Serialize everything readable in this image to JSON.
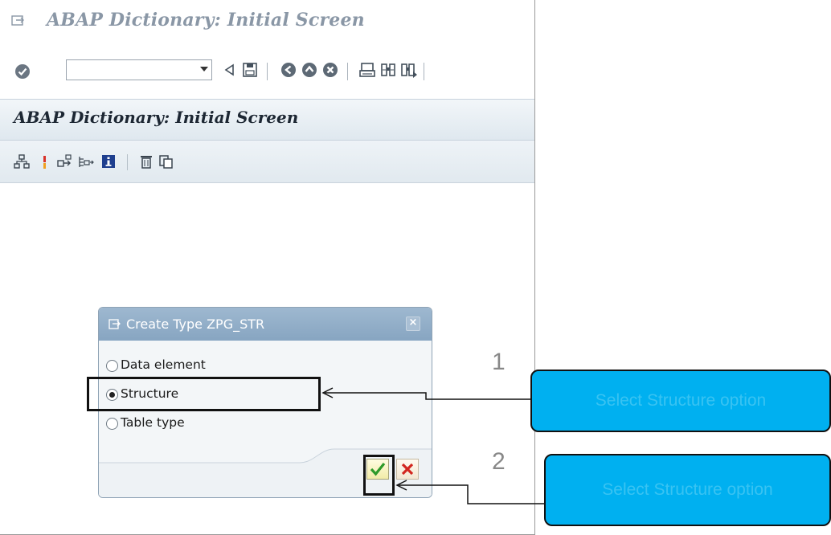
{
  "window": {
    "title": "ABAP Dictionary: Initial Screen"
  },
  "toolbar": {
    "command_field_value": ""
  },
  "screen": {
    "subtitle": "ABAP Dictionary: Initial Screen"
  },
  "dialog": {
    "title": "Create Type ZPG_STR",
    "close_label": "×",
    "options": [
      {
        "label": "Data element",
        "selected": false
      },
      {
        "label": "Structure",
        "selected": true
      },
      {
        "label": "Table type",
        "selected": false
      }
    ],
    "ok_icon": "checkmark-icon",
    "cancel_icon": "cross-icon"
  },
  "annotations": {
    "step1_number": "1",
    "step2_number": "2",
    "callout1_text": "Select Structure option",
    "callout2_text": "Select Structure option",
    "callout_color": "#00b0f0"
  }
}
